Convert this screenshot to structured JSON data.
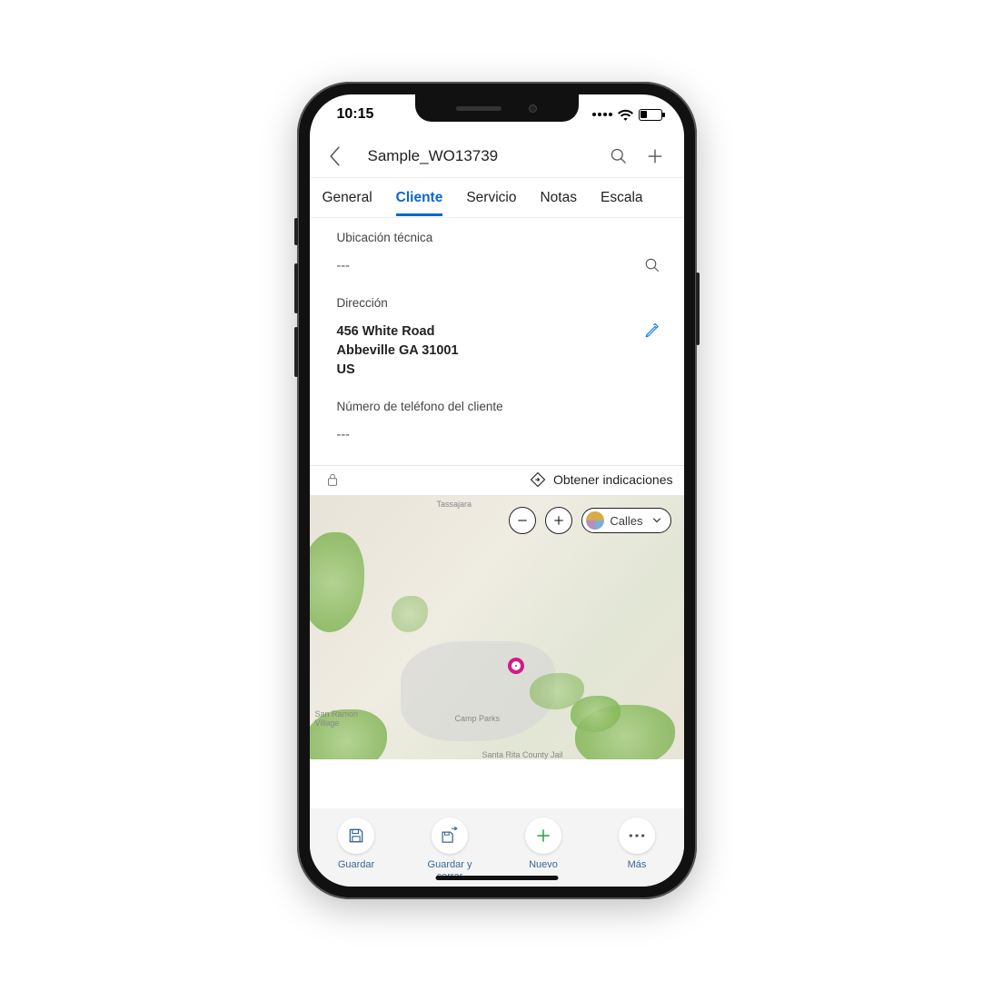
{
  "status": {
    "time": "10:15"
  },
  "header": {
    "title": "Sample_WO13739"
  },
  "tabs": {
    "general": "General",
    "cliente": "Cliente",
    "servicio": "Servicio",
    "notas": "Notas",
    "escala": "Escala"
  },
  "fields": {
    "tech_loc_label": "Ubicación técnica",
    "tech_loc_value": "---",
    "address_label": "Dirección",
    "address_line1": "456 White Road",
    "address_line2": "Abbeville GA 31001",
    "address_line3": "US",
    "phone_label": "Número de teléfono del cliente",
    "phone_value": "---"
  },
  "map": {
    "directions": "Obtener indicaciones",
    "type_selector": "Calles",
    "labels": {
      "top": "Tassajara",
      "sr": "San Ramon\nVillage",
      "cp": "Camp Parks",
      "jail": "Santa Rita County Jail"
    }
  },
  "bottom": {
    "save": "Guardar",
    "save_close": "Guardar y\ncerrar",
    "new": "Nuevo",
    "more": "Más"
  }
}
